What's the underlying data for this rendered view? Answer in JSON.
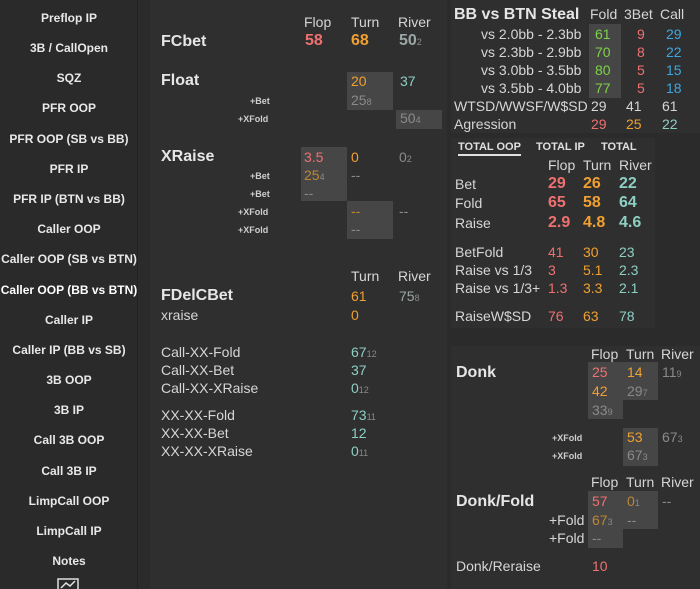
{
  "sidebar": {
    "items": [
      {
        "label": "Preflop IP"
      },
      {
        "label": "3B / CallOpen"
      },
      {
        "label": "SQZ"
      },
      {
        "label": "PFR OOP"
      },
      {
        "label": "PFR OOP (SB vs BB)"
      },
      {
        "label": "PFR IP"
      },
      {
        "label": "PFR IP (BTN vs BB)"
      },
      {
        "label": "Caller OOP"
      },
      {
        "label": "Caller OOP (SB vs BTN)"
      },
      {
        "label": "Caller OOP (BB vs BTN)"
      },
      {
        "label": "Caller IP"
      },
      {
        "label": "Caller IP (BB vs SB)"
      },
      {
        "label": "3B OOP"
      },
      {
        "label": "3B IP"
      },
      {
        "label": "Call 3B OOP"
      },
      {
        "label": "Call 3B IP"
      },
      {
        "label": "LimpCall OOP"
      },
      {
        "label": "LimpCall IP"
      },
      {
        "label": "Notes"
      }
    ],
    "selected": "Caller OOP (BB vs BTN)",
    "bottom_icon": "chart-icon"
  },
  "left": {
    "headers": {
      "flop": "Flop",
      "turn": "Turn",
      "river": "River"
    },
    "fcbet": {
      "title": "FCbet",
      "flop": "58",
      "turn": "68",
      "river": "50",
      "river_n": "2"
    },
    "float": {
      "title": "Float",
      "flop": "20",
      "turn": "37",
      "bet_label": "+Bet",
      "bet_val": "25",
      "bet_n": "8",
      "xfold_label": "+XFold",
      "xfold_val": "50",
      "xfold_n": "4"
    },
    "xraise": {
      "title": "XRaise",
      "flop": "3.5",
      "turn": "0",
      "river": "0",
      "river_n": "2",
      "bet1_label": "+Bet",
      "bet1_val": "25",
      "bet1_n": "4",
      "bet1_turn": "--",
      "bet2_label": "+Bet",
      "bet2_val": "--",
      "xfold1_label": "+XFold",
      "xfold1_turn": "--",
      "xfold1_river": "--",
      "xfold2_label": "+XFold",
      "xfold2_turn": "--"
    },
    "fdelcbet": {
      "turn_hdr": "Turn",
      "river_hdr": "River",
      "title": "FDelCBet",
      "turn": "61",
      "river": "75",
      "river_n": "8",
      "xraise_label": "xraise",
      "xraise_turn": "0"
    },
    "lines": [
      {
        "label": "Call-XX-Fold",
        "val": "67",
        "n": "12"
      },
      {
        "label": "Call-XX-Bet",
        "val": "37",
        "n": ""
      },
      {
        "label": "Call-XX-XRaise",
        "val": "0",
        "n": "12"
      },
      {
        "label": "XX-XX-Fold",
        "val": "73",
        "n": "11"
      },
      {
        "label": "XX-XX-Bet",
        "val": "12",
        "n": ""
      },
      {
        "label": "XX-XX-XRaise",
        "val": "0",
        "n": "11"
      }
    ]
  },
  "steal": {
    "title": "BB vs BTN Steal",
    "headers": {
      "fold": "Fold",
      "bet3": "3Bet",
      "call": "Call"
    },
    "rows": [
      {
        "label": "vs 2.0bb - 2.3bb",
        "fold": "61",
        "bet3": "9",
        "call": "29"
      },
      {
        "label": "vs 2.3bb - 2.9bb",
        "fold": "70",
        "bet3": "8",
        "call": "22"
      },
      {
        "label": "vs 3.0bb - 3.5bb",
        "fold": "80",
        "bet3": "5",
        "call": "15"
      },
      {
        "label": "vs 3.5bb - 4.0bb",
        "fold": "77",
        "bet3": "5",
        "call": "18"
      }
    ],
    "wtsd": {
      "label": "WTSD/WWSF/W$SD",
      "a": "29",
      "b": "41",
      "c": "61"
    },
    "agg": {
      "label": "Agression",
      "a": "29",
      "b": "25",
      "c": "22"
    }
  },
  "totals": {
    "tabs": [
      "TOTAL OOP",
      "TOTAL IP",
      "TOTAL"
    ],
    "active_tab": "TOTAL OOP",
    "headers": {
      "flop": "Flop",
      "turn": "Turn",
      "river": "River"
    },
    "bet": {
      "label": "Bet",
      "flop": "29",
      "turn": "26",
      "river": "22"
    },
    "fold": {
      "label": "Fold",
      "flop": "65",
      "turn": "58",
      "river": "64"
    },
    "raise": {
      "label": "Raise",
      "flop": "2.9",
      "turn": "4.8",
      "river": "4.6"
    },
    "betfold": {
      "label": "BetFold",
      "flop": "41",
      "turn": "30",
      "river": "23"
    },
    "r13": {
      "label": "Raise vs 1/3",
      "flop": "3",
      "turn": "5.1",
      "river": "2.3"
    },
    "r13p": {
      "label": "Raise vs 1/3+",
      "flop": "1.3",
      "turn": "3.3",
      "river": "2.1"
    },
    "raisewsd": {
      "label": "RaiseW$SD",
      "flop": "76",
      "turn": "63",
      "river": "78"
    }
  },
  "donk": {
    "headers": {
      "flop": "Flop",
      "turn": "Turn",
      "river": "River"
    },
    "title": "Donk",
    "flop1": "25",
    "turn1": "14",
    "river1": "11",
    "river1_n": "9",
    "flop2": "42",
    "turn2": "29",
    "turn2_n": "7",
    "flop3": "33",
    "flop3_n": "9",
    "xfold1_label": "+XFold",
    "xfold1_turn": "53",
    "xfold1_river": "67",
    "xfold1_river_n": "3",
    "xfold2_label": "+XFold",
    "xfold2_turn": "67",
    "xfold2_turn_n": "3"
  },
  "donkfold": {
    "headers": {
      "flop": "Flop",
      "turn": "Turn",
      "river": "River"
    },
    "title": "Donk/Fold",
    "flop": "57",
    "turn": "0",
    "turn_n": "1",
    "river": "--",
    "fold1_label": "+Fold",
    "fold1_flop": "67",
    "fold1_flop_n": "3",
    "fold1_turn": "--",
    "fold2_label": "+Fold",
    "fold2_flop": "--",
    "reraise_label": "Donk/Reraise",
    "reraise_val": "10"
  }
}
